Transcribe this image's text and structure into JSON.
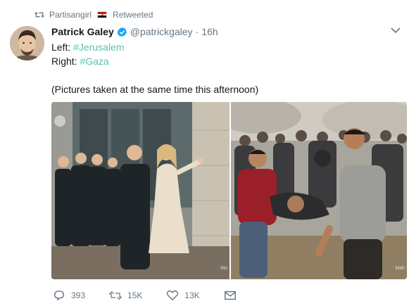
{
  "retweet_context": {
    "retweeter_name": "Partisangirl",
    "label": "Retweeted",
    "icon": "retweet-icon",
    "flag": "egypt-flag-icon"
  },
  "tweet": {
    "author_name": "Patrick Galey",
    "handle": "@patrickgaley",
    "separator": "·",
    "time": "16h",
    "verified": true,
    "lines": {
      "left_label": "Left:",
      "left_hashtag": "#Jerusalem",
      "right_label": "Right:",
      "right_hashtag": "#Gaza",
      "note": "(Pictures taken at the same time this afternoon)"
    }
  },
  "media": {
    "left_watermark": "Mo",
    "right_watermark": "Mah"
  },
  "actions": {
    "reply_count": "393",
    "retweet_count": "15K",
    "like_count": "13K"
  },
  "colors": {
    "hashtag": "#5bc3ad",
    "muted": "#657786",
    "verified": "#1da1f2",
    "text": "#14171a"
  }
}
